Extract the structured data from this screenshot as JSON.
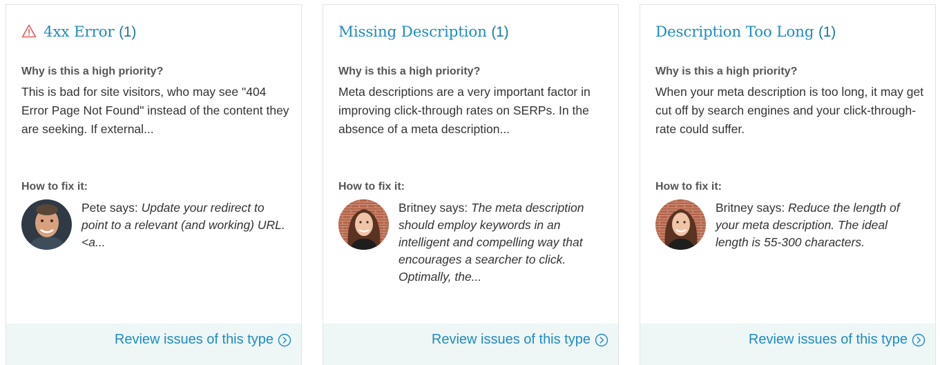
{
  "cards": [
    {
      "title": "4xx Error",
      "count": "(1)",
      "has_warning_icon": true,
      "why_label": "Why is this a high priority?",
      "why_text": "This is bad for site visitors, who may see \"404 Error Page Not Found\" instead of the content they are seeking. If external...",
      "fix_label": "How to fix it:",
      "advisor": "Pete",
      "says": " says: ",
      "advice": "Update your redirect to point to a relevant (and working) URL. <a...",
      "review_label": "Review issues of this type",
      "review_icon": "chevron-right-circle-icon"
    },
    {
      "title": "Missing Description",
      "count": "(1)",
      "has_warning_icon": false,
      "why_label": "Why is this a high priority?",
      "why_text": "Meta descriptions are a very important factor in improving click-through rates on SERPs. In the absence of a meta description...",
      "fix_label": "How to fix it:",
      "advisor": "Britney",
      "says": " says: ",
      "advice": "The meta description should employ keywords in an intelligent and compelling way that encourages a searcher to click. Optimally, the...",
      "review_label": "Review issues of this type",
      "review_icon": "chevron-right-circle-icon"
    },
    {
      "title": "Description Too Long",
      "count": "(1)",
      "has_warning_icon": false,
      "why_label": "Why is this a high priority?",
      "why_text": "When your meta description is too long, it may get cut off by search engines and your click-through-rate could suffer.",
      "fix_label": "How to fix it:",
      "advisor": "Britney",
      "says": " says: ",
      "advice": "Reduce the length of your meta description. The ideal length is 55-300 characters.",
      "review_label": "Review issues of this type",
      "review_icon": "chevron-right-circle-icon"
    }
  ],
  "colors": {
    "link": "#1d8bc2",
    "warning": "#e05a5a",
    "footer_bg": "#eef6f6"
  }
}
